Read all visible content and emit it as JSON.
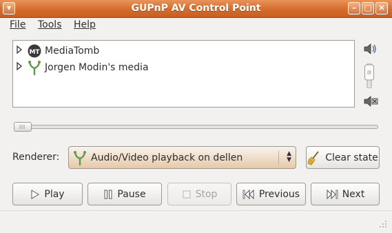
{
  "window": {
    "title": "GUPnP AV Control Point"
  },
  "menu": {
    "file": "File",
    "tools": "Tools",
    "help": "Help"
  },
  "devices": [
    {
      "label": "MediaTomb",
      "icon": "mediatomb-logo-icon"
    },
    {
      "label": "Jorgen Modin's media",
      "icon": "upnp-device-icon"
    }
  ],
  "renderer": {
    "label": "Renderer:",
    "selected": "Audio/Video playback on dellen"
  },
  "buttons": {
    "clear_state": "Clear state",
    "play": "Play",
    "pause": "Pause",
    "stop": "Stop",
    "previous": "Previous",
    "next": "Next"
  },
  "position_slider": {
    "value_fraction": 0.0
  },
  "colors": {
    "titlebar": "#d56b2b",
    "device_icon_green": "#5f9c4a",
    "accent": "#e9935a"
  }
}
